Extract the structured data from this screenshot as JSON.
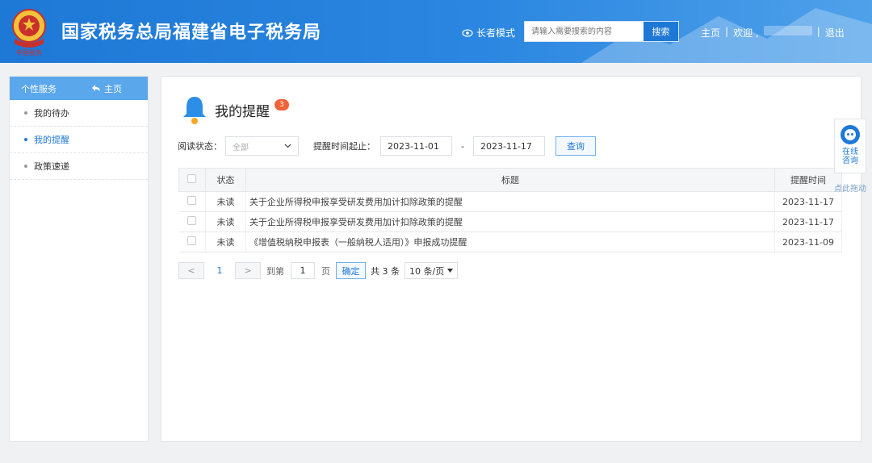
{
  "header": {
    "title": "国家税务总局福建省电子税务局",
    "emblem_caption": "中国税务",
    "elder_mode_label": "长者模式",
    "search_placeholder": "请输入需要搜索的内容",
    "search_button": "搜索",
    "nav_home": "主页",
    "nav_welcome": "欢迎 ,",
    "nav_logout": "退出",
    "separator": "|"
  },
  "sidebar": {
    "head_label": "个性服务",
    "home_label": "主页",
    "items": [
      {
        "label": "我的待办",
        "active": false
      },
      {
        "label": "我的提醒",
        "active": true
      },
      {
        "label": "政策速递",
        "active": false
      }
    ]
  },
  "main": {
    "title": "我的提醒",
    "badge_count": "3",
    "filters": {
      "read_status_label": "阅读状态：",
      "read_status_value": "全部",
      "time_range_label": "提醒时间起止：",
      "date_start": "2023-11-01",
      "date_sep": "-",
      "date_end": "2023-11-17",
      "query_button": "查询"
    },
    "table": {
      "headers": {
        "status": "状态",
        "title": "标题",
        "time": "提醒时间"
      },
      "rows": [
        {
          "status": "未读",
          "title": "关于企业所得税申报享受研发费用加计扣除政策的提醒",
          "time": "2023-11-17"
        },
        {
          "status": "未读",
          "title": "关于企业所得税申报享受研发费用加计扣除政策的提醒",
          "time": "2023-11-17"
        },
        {
          "status": "未读",
          "title": "《增值税纳税申报表（一般纳税人适用）》申报成功提醒",
          "time": "2023-11-09"
        }
      ]
    },
    "pager": {
      "prev": "<",
      "current_page": "1",
      "next": ">",
      "goto_label": "到第",
      "goto_value": "1",
      "page_unit": "页",
      "confirm": "确定",
      "total": "共 3 条",
      "page_size": "10 条/页"
    }
  },
  "consult": {
    "label_line1": "在线",
    "label_line2": "咨询",
    "drag_hint": "点此拖动"
  },
  "colors": {
    "header_blue": "#1e78d6",
    "accent": "#1e78d6",
    "badge": "#f06237",
    "sidebar_head": "#5aa7ec"
  }
}
